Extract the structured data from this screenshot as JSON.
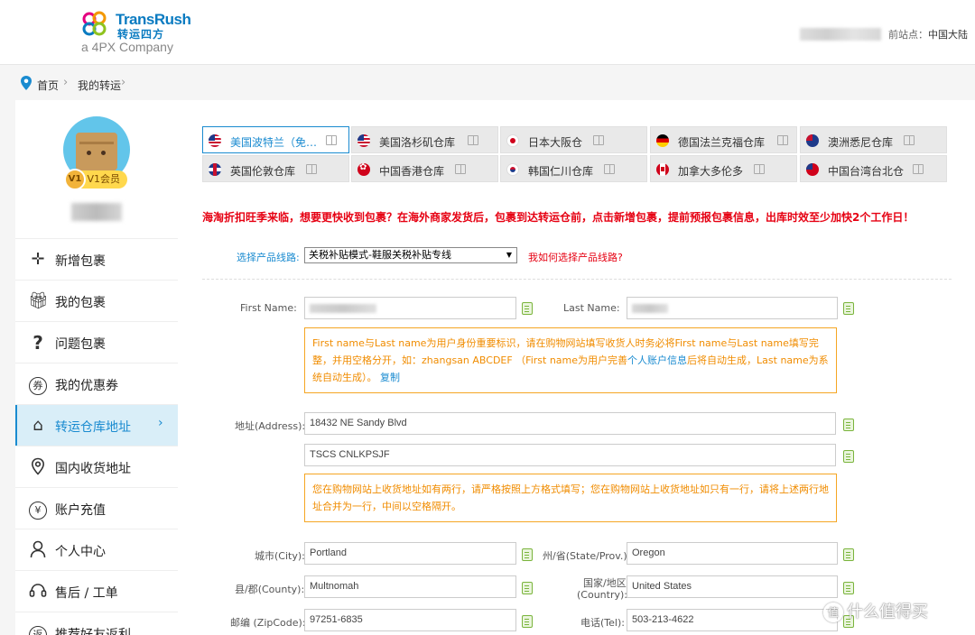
{
  "header": {
    "logo_brand": "TransRush",
    "logo_cn": "转运四方",
    "logo_sub": "a 4PX Company",
    "station_label": "前站点：",
    "station_value": "中国大陆"
  },
  "breadcrumb": {
    "home": "首页",
    "current": "我的转运"
  },
  "sidebar": {
    "vip_badge": "V1会员",
    "vip_mark": "V1",
    "menu": [
      {
        "label": "新增包裹",
        "icon": "plus-icon"
      },
      {
        "label": "我的包裹",
        "icon": "gift-icon"
      },
      {
        "label": "问题包裹",
        "icon": "question-icon"
      },
      {
        "label": "我的优惠券",
        "icon": "coupon-icon"
      },
      {
        "label": "转运仓库地址",
        "icon": "house-icon"
      },
      {
        "label": "国内收货地址",
        "icon": "location-icon"
      },
      {
        "label": "账户充值",
        "icon": "yen-icon"
      },
      {
        "label": "个人中心",
        "icon": "user-icon"
      },
      {
        "label": "售后 / 工单",
        "icon": "headset-icon"
      },
      {
        "label": "推荐好友返利",
        "icon": "rebate-icon"
      }
    ],
    "active_chevron": "›"
  },
  "tabs": [
    {
      "label": "美国波特兰（免…",
      "flag": "us"
    },
    {
      "label": "美国洛杉矶仓库",
      "flag": "us"
    },
    {
      "label": "日本大阪仓",
      "flag": "jp"
    },
    {
      "label": "德国法兰克福仓库",
      "flag": "de"
    },
    {
      "label": "澳洲悉尼仓库",
      "flag": "au"
    },
    {
      "label": "英国伦敦仓库",
      "flag": "uk"
    },
    {
      "label": "中国香港仓库",
      "flag": "hk"
    },
    {
      "label": "韩国仁川仓库",
      "flag": "kr"
    },
    {
      "label": "加拿大多伦多",
      "flag": "ca"
    },
    {
      "label": "中国台湾台北仓",
      "flag": "tw"
    }
  ],
  "notice": "海淘折扣旺季来临，想要更快收到包裹？在海外商家发货后，包裹到达转运仓前，点击新增包裹，提前预报包裹信息，出库时效至少加快2个工作日！",
  "route": {
    "label": "选择产品线路:",
    "selected": "关税补贴模式-鞋服关税补贴专线",
    "help": "我如何选择产品线路?"
  },
  "form": {
    "first_name_label": "First Name:",
    "last_name_label": "Last Name:",
    "name_tip_1": "First name与Last name为用户身份重要标识，请在购物网站填写收货人时务必将First name与Last name填写完整，并用空格分开，如：zhangsan ABCDEF （First name为用户完善",
    "name_tip_link": "个人账户信息",
    "name_tip_2": "后将自动生成，Last name为系统自动生成）。",
    "name_tip_copy": "复制",
    "address_label": "地址(Address):",
    "address1": "18432 NE Sandy Blvd",
    "address2": "TSCS CNLKPSJF",
    "address_tip": "您在购物网站上收货地址如有两行，请严格按照上方格式填写；您在购物网站上收货地址如只有一行，请将上述两行地址合并为一行，中间以空格隔开。",
    "city_label": "城市(City):",
    "city": "Portland",
    "state_label": "州/省(State/Prov.):",
    "state": "Oregon",
    "county_label": "县/郡(County):",
    "county": "Multnomah",
    "country_label_1": "国家/地区",
    "country_label_2": "(Country):",
    "country": "United States",
    "zip_label": "邮编 (ZipCode):",
    "zip": "97251-6835",
    "tel_label": "电话(Tel):",
    "tel": "503-213-4622"
  },
  "watermark": {
    "icon_text": "值",
    "text": "什么值得买"
  }
}
